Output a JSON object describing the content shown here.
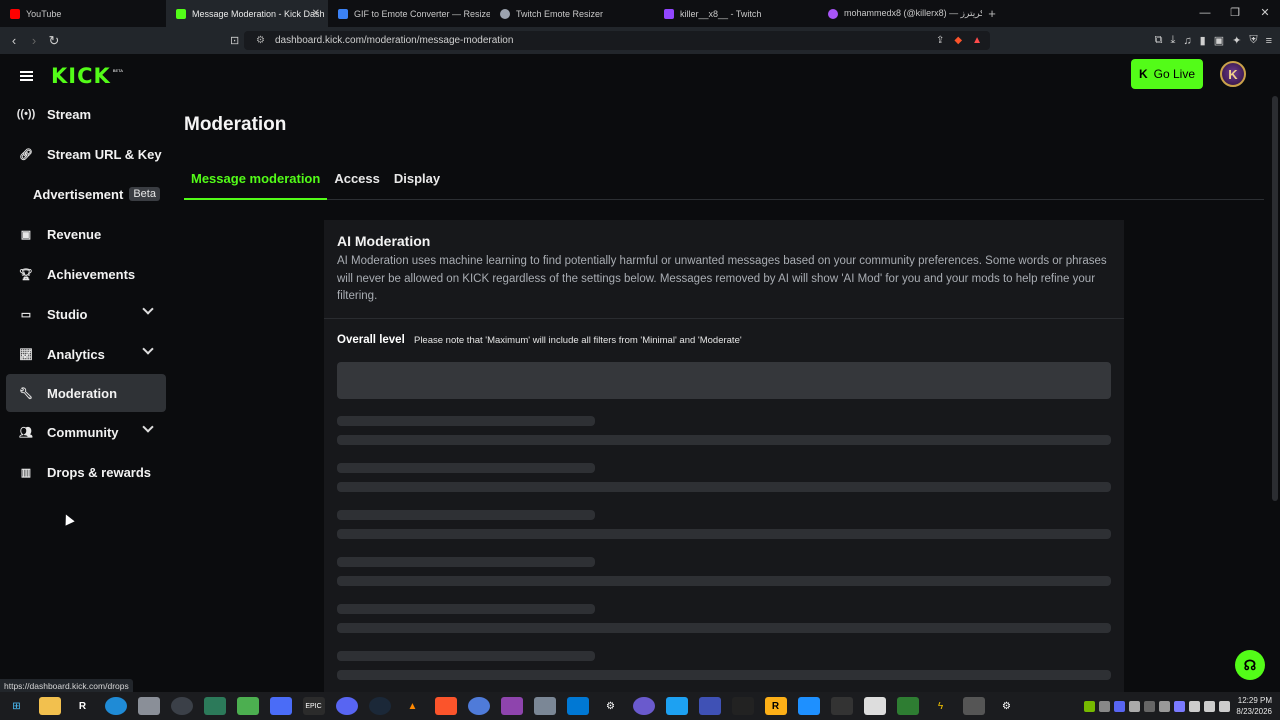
{
  "browser": {
    "tabs": [
      {
        "title": "YouTube",
        "color": "#ff0000"
      },
      {
        "title": "Message Moderation - Kick Dash",
        "color": "#53fc18",
        "active": true
      },
      {
        "title": "GIF to Emote Converter — Resize for",
        "color": "#3b82f6"
      },
      {
        "title": "Twitch Emote Resizer",
        "color": "#9ca3af"
      },
      {
        "title": "killer__x8__ - Twitch",
        "color": "#9146ff"
      },
      {
        "title": "mohammedx8 (@killerx8) — كريترز",
        "color": "#a855f7"
      }
    ],
    "new_tab": "+",
    "url": "dashboard.kick.com/moderation/message-moderation",
    "status_url": "https://dashboard.kick.com/drops"
  },
  "header": {
    "logo": "KICK",
    "logo_badge": "BETA",
    "go_live": "Go Live",
    "avatar_letter": "K"
  },
  "sidebar": {
    "items": [
      {
        "label": "Stream",
        "icon": "broadcast-icon"
      },
      {
        "label": "Stream URL & Key",
        "icon": "link-icon"
      },
      {
        "label": "Advertisement",
        "badge": "Beta"
      },
      {
        "label": "Revenue",
        "icon": "wallet-icon"
      },
      {
        "label": "Achievements",
        "icon": "trophy-icon"
      },
      {
        "label": "Studio",
        "icon": "studio-icon",
        "expandable": true
      },
      {
        "label": "Analytics",
        "icon": "chart-icon",
        "expandable": true
      },
      {
        "label": "Moderation",
        "icon": "wrench-icon",
        "active": true
      },
      {
        "label": "Community",
        "icon": "community-icon",
        "expandable": true
      },
      {
        "label": "Drops & rewards",
        "icon": "drops-icon"
      }
    ]
  },
  "main": {
    "title": "Moderation",
    "tabs": [
      "Message moderation",
      "Access",
      "Display"
    ],
    "active_tab": "Message moderation",
    "card": {
      "title": "AI Moderation",
      "description": "AI Moderation uses machine learning to find potentially harmful or unwanted messages based on your community preferences. Some words or phrases will never be allowed on KICK regardless of the settings below. Messages removed by AI will show 'AI Mod' for you and your mods to help refine your filtering.",
      "level_label": "Overall level",
      "level_note": "Please note that 'Maximum' will include all filters from 'Minimal' and 'Moderate'"
    }
  },
  "taskbar": {
    "time": "12:29 PM",
    "date": "8/23/2026"
  },
  "colors": {
    "accent": "#53fc18",
    "background": "#0b0c0e",
    "card": "#17181b"
  }
}
